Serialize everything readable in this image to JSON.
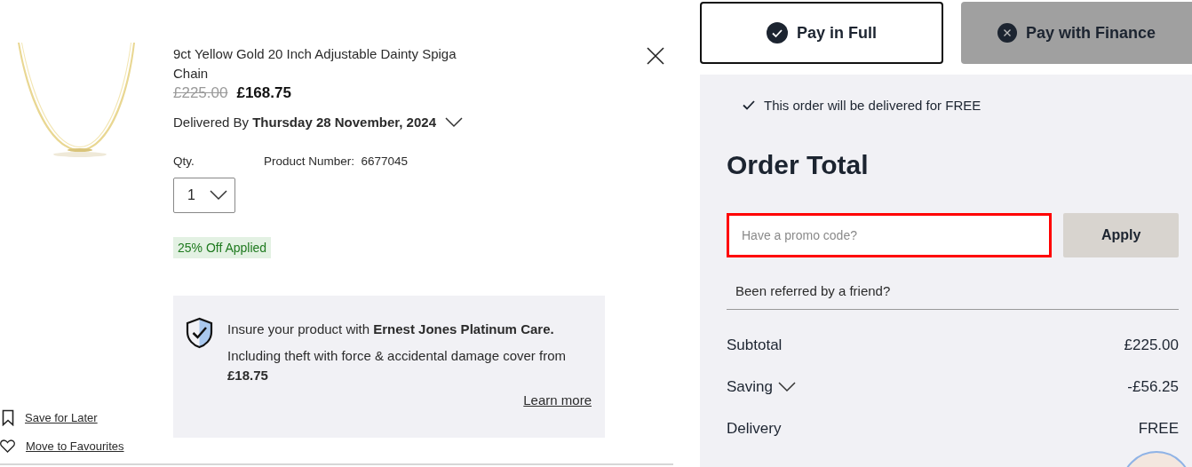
{
  "product": {
    "title": "9ct Yellow Gold 20 Inch Adjustable Dainty Spiga Chain",
    "price_was": "£225.00",
    "price_now": "£168.75",
    "delivery_label": "Delivered By",
    "delivery_date": "Thursday 28 November, 2024",
    "qty_label": "Qty.",
    "qty": "1",
    "product_number_label": "Product Number:",
    "product_number": "6677045",
    "discount_badge": "25% Off Applied"
  },
  "insurance": {
    "text": "Insure your product with **Ernest Jones Platinum Care.**",
    "detail": "Including theft with force & accidental damage cover from **£18.75**",
    "link": "Learn more"
  },
  "actions": [
    {
      "kind": "save",
      "label": "Save for Later"
    },
    {
      "kind": "favourite",
      "label": "Move to Favourites"
    }
  ],
  "payment_tabs": [
    {
      "label": "Pay in Full",
      "selected": true
    },
    {
      "label": "Pay with Finance",
      "selected": false
    }
  ],
  "summary": {
    "delivery_notice": "This order will be delivered for FREE",
    "title": "Order Total",
    "promo": {
      "placeholder": "Have a promo code?",
      "highlighted": true
    },
    "apply": "Apply",
    "referral": "Been referred by a friend?",
    "rows": [
      {
        "label": "Subtotal",
        "value": "£225.00",
        "expandable": false
      },
      {
        "label": "Saving",
        "value": "-£56.25",
        "expandable": true
      },
      {
        "label": "Delivery",
        "value": "FREE",
        "expandable": false
      }
    ]
  }
}
